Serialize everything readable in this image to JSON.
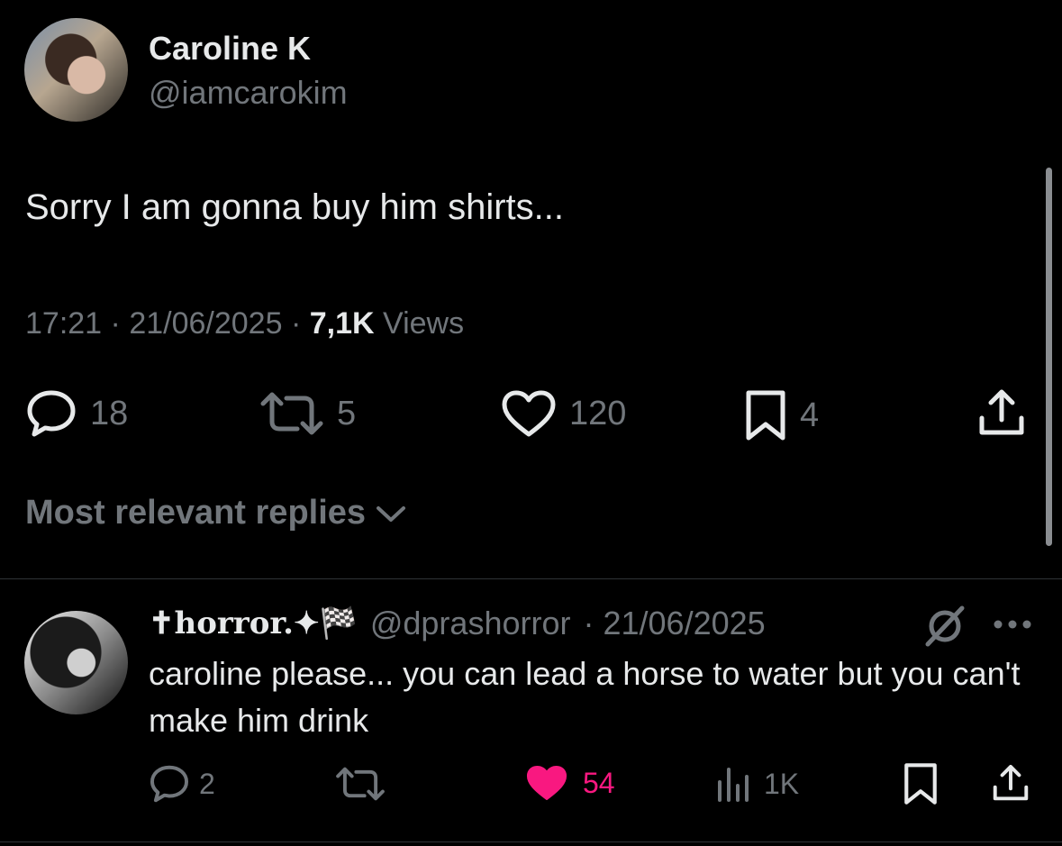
{
  "tweet": {
    "author": {
      "display_name": "Caroline K",
      "handle": "@iamcarokim"
    },
    "text": "Sorry I am gonna buy him shirts...",
    "time": "17:21",
    "date": "21/06/2025",
    "views_count": "7,1K",
    "views_label": "Views",
    "separator": "·",
    "stats": {
      "replies": "18",
      "reposts": "5",
      "likes": "120",
      "bookmarks": "4"
    }
  },
  "replies_sort": {
    "label": "Most relevant replies"
  },
  "reply": {
    "author": {
      "display_name": "✝horror.✦🏁",
      "handle": "@dprashorror"
    },
    "date": "· 21/06/2025",
    "text": "caroline please... you can lead a horse to water but you can't make him drink",
    "stats": {
      "replies": "2",
      "likes": "54",
      "views": "1K"
    },
    "liked": true
  },
  "colors": {
    "background": "#000000",
    "text": "#e7e9ea",
    "muted": "#71767b",
    "like": "#f91880"
  }
}
